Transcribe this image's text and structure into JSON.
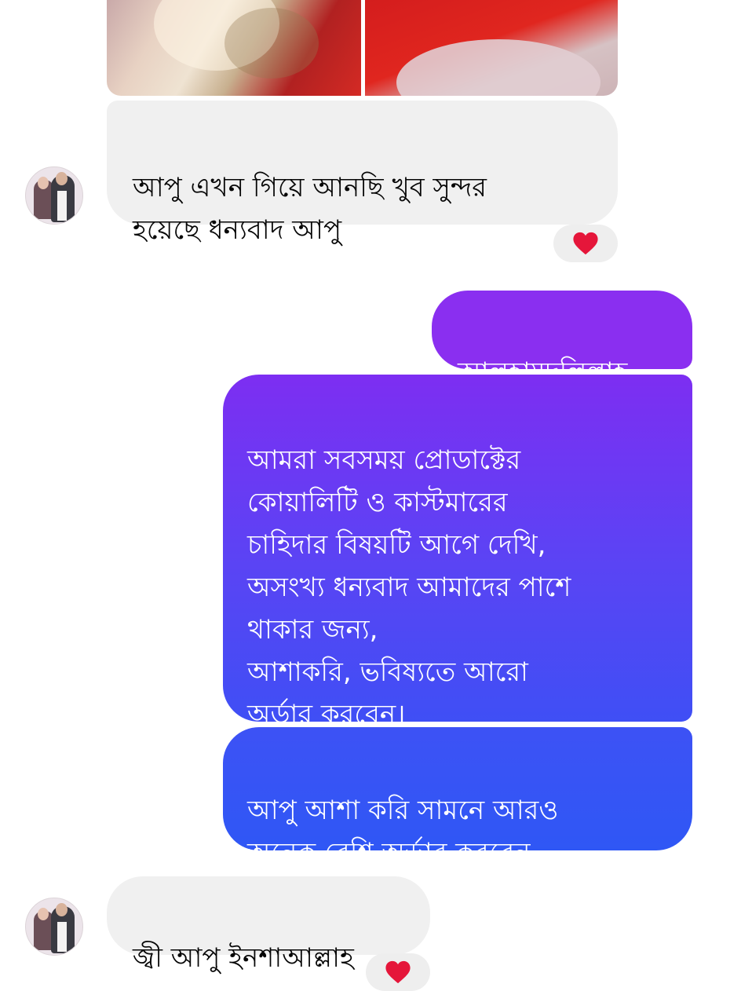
{
  "thread": {
    "incoming_1": {
      "text": "আপু এখন  গিয়ে আনছি খুব সুন্দর\nহয়েছে ধন্যবাদ  আপু",
      "reaction": "heart"
    },
    "outgoing_1": {
      "text": "আলহামদুলিল্লাহ"
    },
    "outgoing_2": {
      "text": "আমরা সবসময় প্রোডাক্টের\nকোয়ালিটি ও কাস্টমারের\nচাহিদার বিষয়টি আগে দেখি,\nঅসংখ্য ধন্যবাদ আমাদের পাশে\nথাকার জন্য,\nআশাকরি,  ভবিষ্যতে আরো\nঅর্ডার করবেন।"
    },
    "outgoing_3": {
      "text": "আপু আশা করি সামনে আরও\nঅনেক বেশি অর্ডার করবেন"
    },
    "incoming_2": {
      "text": "জ্বী আপু ইনশাআল্লাহ",
      "reaction": "heart"
    }
  },
  "colors": {
    "incoming_bubble": "#f0f0f0",
    "outgoing_gradient_top": "#8a2ff0",
    "outgoing_gradient_bottom": "#2f55f5",
    "heart": "#e5163a"
  },
  "icons": [
    "heart-reaction-icon",
    "contact-avatar",
    "photo-attachment"
  ]
}
